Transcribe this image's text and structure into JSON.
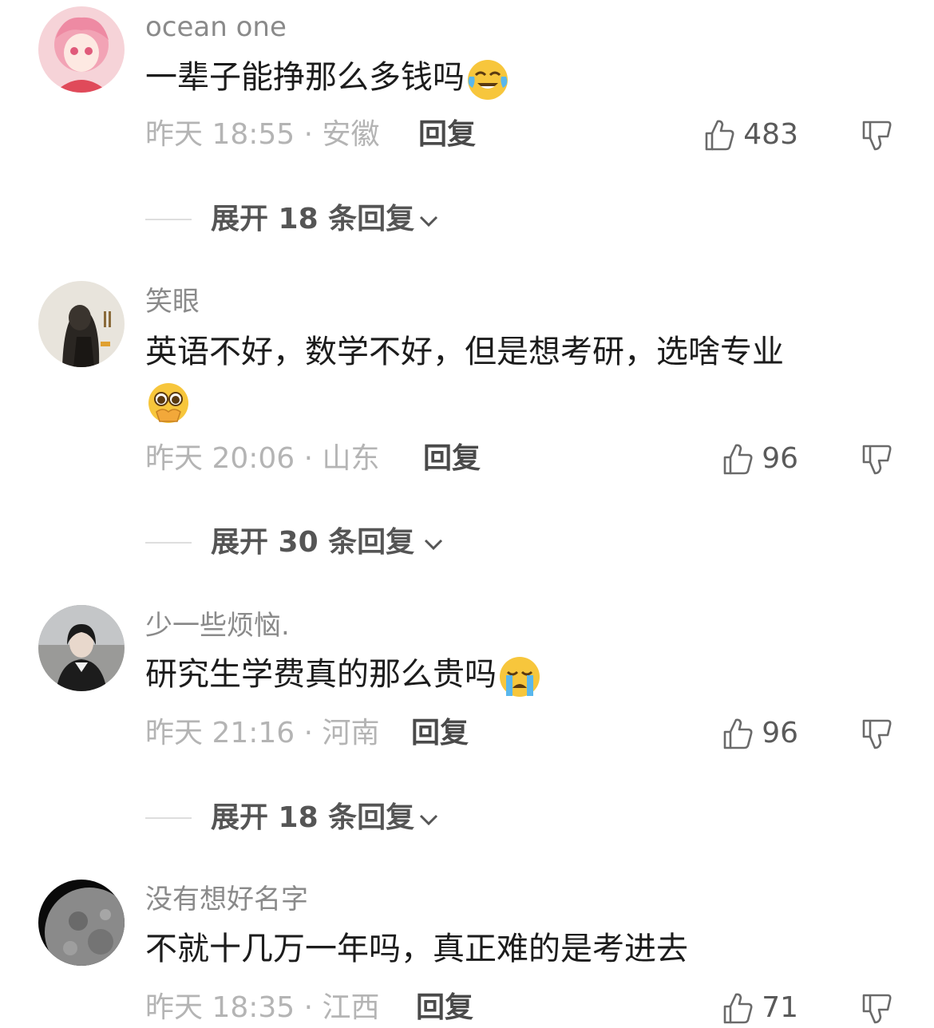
{
  "comments": [
    {
      "username": "ocean one",
      "text": "一辈子能挣那么多钱吗",
      "emoji": "tears-of-joy-emoji",
      "time_location": "昨天 18:55 · 安徽",
      "reply_label": "回复",
      "likes": "483",
      "expand_label": "展开 18 条回复"
    },
    {
      "username": "笑眼",
      "text": "英语不好，数学不好，但是想考研，选啥专业",
      "emoji": "pleading-face-emoji",
      "time_location": "昨天 20:06 · 山东",
      "reply_label": "回复",
      "likes": "96",
      "expand_label": "展开 30 条回复"
    },
    {
      "username": "少一些烦恼.",
      "text": "研究生学费真的那么贵吗",
      "emoji": "crying-face-emoji",
      "time_location": "昨天 21:16 · 河南",
      "reply_label": "回复",
      "likes": "96",
      "expand_label": "展开 18 条回复"
    },
    {
      "username": "没有想好名字",
      "text": "不就十几万一年吗，真正难的是考进去",
      "time_location": "昨天 18:35 · 江西",
      "reply_label": "回复",
      "likes": "71"
    }
  ],
  "icons": {
    "like": "thumbs-up-icon",
    "dislike": "thumbs-down-icon",
    "expand": "chevron-down-icon"
  },
  "colors": {
    "username": "#8a8a8a",
    "content": "#1c1c1c",
    "meta": "#b4b4b4",
    "emoji_yellow": "#f7c63c",
    "tear_blue": "#59b7ec"
  }
}
